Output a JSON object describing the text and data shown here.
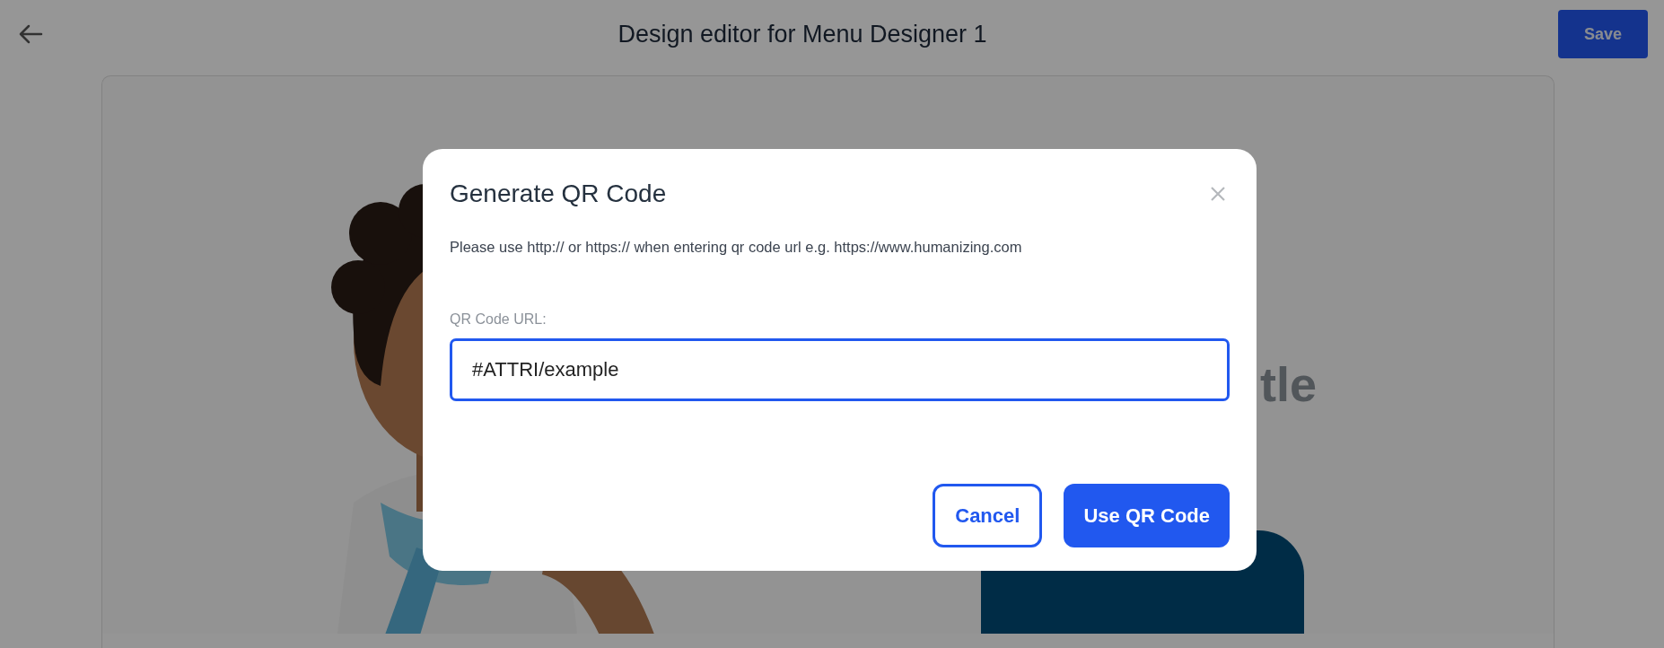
{
  "header": {
    "title": "Design editor for Menu Designer 1",
    "save_button": "Save"
  },
  "canvas": {
    "heading": "tle"
  },
  "dialog": {
    "title": "Generate QR Code",
    "description": "Please use http:// or https:// when entering qr code url e.g. https://www.humanizing.com",
    "field": {
      "label": "QR Code URL:",
      "value": "#ATTRI/example",
      "focused": true
    },
    "buttons": [
      {
        "label": "Cancel",
        "kind": "secondary"
      },
      {
        "label": "Use QR Code",
        "kind": "primary"
      }
    ]
  }
}
